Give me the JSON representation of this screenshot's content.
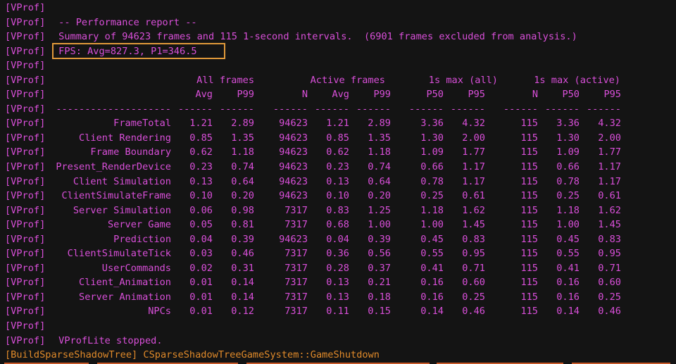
{
  "prefix": "[VProf]",
  "intro": [
    "",
    " -- Performance report --",
    " Summary of 94623 frames and 115 1-second intervals.  (6901 frames excluded from analysis.)",
    " FPS: Avg=827.3, P1=346.5",
    ""
  ],
  "group_headers": {
    "all_frames": "All frames",
    "active_frames": "Active frames",
    "max_all": "1s max (all)",
    "max_active": "1s max (active)"
  },
  "column_headers": [
    "",
    "Avg",
    "P99",
    "N",
    "Avg",
    "P99",
    "P50",
    "P95",
    "N",
    "P50",
    "P95"
  ],
  "separators": [
    "--------------------",
    "------",
    "------",
    "------",
    "------",
    "------",
    "------",
    "------",
    "------",
    "------",
    "------"
  ],
  "rows": [
    [
      "FrameTotal",
      "1.21",
      "2.89",
      "94623",
      "1.21",
      "2.89",
      "3.36",
      "4.32",
      "115",
      "3.36",
      "4.32"
    ],
    [
      "Client Rendering",
      "0.85",
      "1.35",
      "94623",
      "0.85",
      "1.35",
      "1.30",
      "2.00",
      "115",
      "1.30",
      "2.00"
    ],
    [
      "Frame Boundary",
      "0.62",
      "1.18",
      "94623",
      "0.62",
      "1.18",
      "1.09",
      "1.77",
      "115",
      "1.09",
      "1.77"
    ],
    [
      "Present_RenderDevice",
      "0.23",
      "0.74",
      "94623",
      "0.23",
      "0.74",
      "0.66",
      "1.17",
      "115",
      "0.66",
      "1.17"
    ],
    [
      "Client Simulation",
      "0.13",
      "0.64",
      "94623",
      "0.13",
      "0.64",
      "0.78",
      "1.17",
      "115",
      "0.78",
      "1.17"
    ],
    [
      "ClientSimulateFrame",
      "0.10",
      "0.20",
      "94623",
      "0.10",
      "0.20",
      "0.25",
      "0.61",
      "115",
      "0.25",
      "0.61"
    ],
    [
      "Server Simulation",
      "0.06",
      "0.98",
      "7317",
      "0.83",
      "1.25",
      "1.18",
      "1.62",
      "115",
      "1.18",
      "1.62"
    ],
    [
      "Server Game",
      "0.05",
      "0.81",
      "7317",
      "0.68",
      "1.00",
      "1.00",
      "1.45",
      "115",
      "1.00",
      "1.45"
    ],
    [
      "Prediction",
      "0.04",
      "0.39",
      "94623",
      "0.04",
      "0.39",
      "0.45",
      "0.83",
      "115",
      "0.45",
      "0.83"
    ],
    [
      "ClientSimulateTick",
      "0.03",
      "0.46",
      "7317",
      "0.36",
      "0.56",
      "0.55",
      "0.95",
      "115",
      "0.55",
      "0.95"
    ],
    [
      "UserCommands",
      "0.02",
      "0.31",
      "7317",
      "0.28",
      "0.37",
      "0.41",
      "0.71",
      "115",
      "0.41",
      "0.71"
    ],
    [
      "Client_Animation",
      "0.01",
      "0.14",
      "7317",
      "0.13",
      "0.21",
      "0.16",
      "0.60",
      "115",
      "0.16",
      "0.60"
    ],
    [
      "Server Animation",
      "0.01",
      "0.14",
      "7317",
      "0.13",
      "0.18",
      "0.16",
      "0.25",
      "115",
      "0.16",
      "0.25"
    ],
    [
      "NPCs",
      "0.01",
      "0.12",
      "7317",
      "0.11",
      "0.15",
      "0.14",
      "0.46",
      "115",
      "0.14",
      "0.46"
    ]
  ],
  "outro": [
    "",
    " VProfLite stopped."
  ],
  "last_line": "[BuildSparseShadowTree] CSparseShadowTreeGameSystem::GameShutdown",
  "colors": {
    "text": "#d94fd9",
    "highlight_box": "#e0993a",
    "last_line": "#e08a2a",
    "background": "#141414"
  }
}
